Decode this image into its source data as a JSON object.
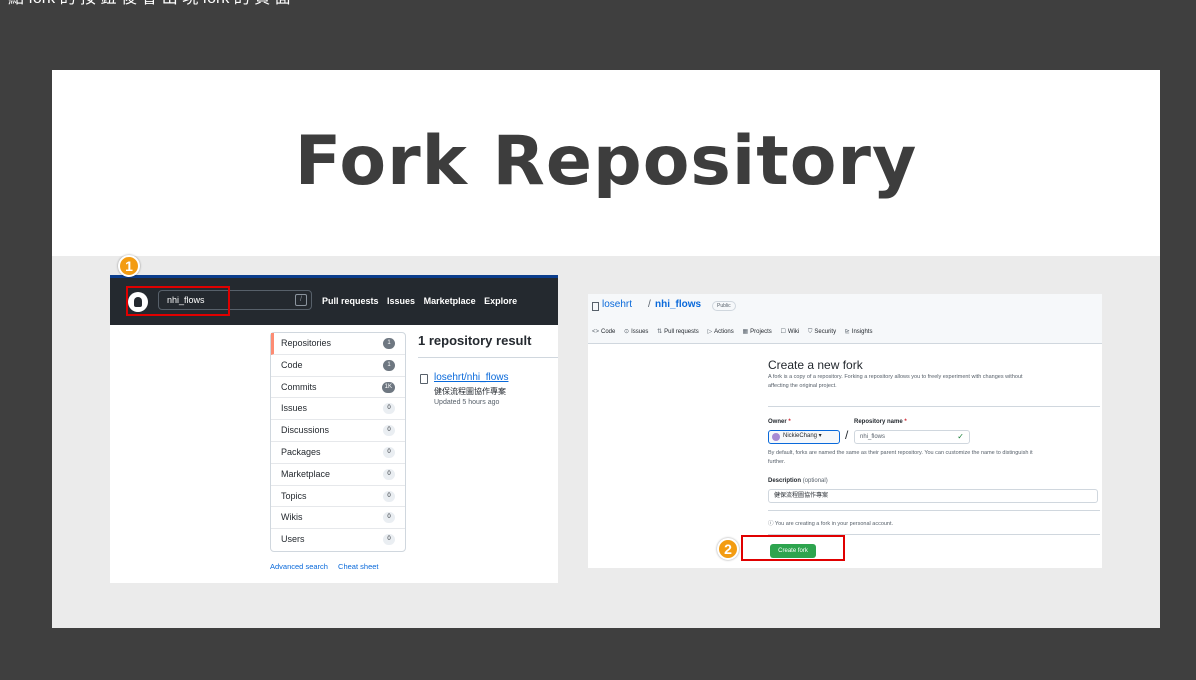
{
  "top_caption": "點 fork 的 按 鈕 後 會 出 現 fork 的 頁 面",
  "slide_title": "Fork Repository",
  "markers": [
    "1",
    "2"
  ],
  "search_page": {
    "search_value": "nhi_flows",
    "search_shortcut": "/",
    "nav": [
      "Pull requests",
      "Issues",
      "Marketplace",
      "Explore"
    ],
    "filters": [
      {
        "label": "Repositories",
        "count": "1"
      },
      {
        "label": "Code",
        "count": "1"
      },
      {
        "label": "Commits",
        "count": "1K"
      },
      {
        "label": "Issues",
        "count": "0"
      },
      {
        "label": "Discussions",
        "count": "0"
      },
      {
        "label": "Packages",
        "count": "0"
      },
      {
        "label": "Marketplace",
        "count": "0"
      },
      {
        "label": "Topics",
        "count": "0"
      },
      {
        "label": "Wikis",
        "count": "0"
      },
      {
        "label": "Users",
        "count": "0"
      }
    ],
    "advanced_search": "Advanced search",
    "cheat_sheet": "Cheat sheet",
    "result_title": "1 repository result",
    "result": {
      "name": "losehrt/nhi_flows",
      "description": "健保流程圖協作專案",
      "updated": "Updated 5 hours ago"
    }
  },
  "fork_page": {
    "owner": "losehrt",
    "separator": "/",
    "repo": "nhi_flows",
    "visibility": "Public",
    "tabs": [
      {
        "icon": "<>",
        "label": "Code"
      },
      {
        "icon": "⊙",
        "label": "Issues"
      },
      {
        "icon": "⇅",
        "label": "Pull requests"
      },
      {
        "icon": "▷",
        "label": "Actions"
      },
      {
        "icon": "▦",
        "label": "Projects"
      },
      {
        "icon": "☐",
        "label": "Wiki"
      },
      {
        "icon": "⛉",
        "label": "Security"
      },
      {
        "icon": "⊵",
        "label": "Insights"
      }
    ],
    "heading": "Create a new fork",
    "subtitle_line1": "A fork is a copy of a repository. Forking a repository allows you to freely experiment with changes without",
    "subtitle_line2": "affecting the original project.",
    "owner_label": "Owner",
    "required_mark": "*",
    "owner_value": "NickieChang ▾",
    "repo_name_label": "Repository name",
    "repo_name_value": "nhi_flows",
    "check_mark": "✓",
    "default_note_line1": "By default, forks are named the same as their parent repository. You can customize the name to distinguish it",
    "default_note_line2": "further.",
    "description_label": "Description",
    "description_optional": "(optional)",
    "description_value": "健保流程圖協作專案",
    "info_text": "ⓘ You are creating a fork in your personal account.",
    "create_button": "Create fork"
  }
}
